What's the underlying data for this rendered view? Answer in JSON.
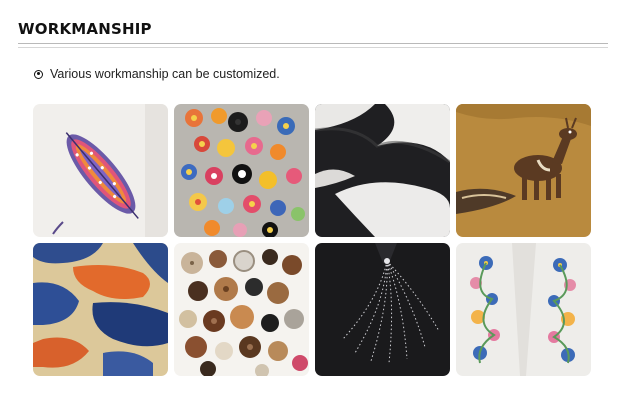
{
  "section": {
    "title": "WORKMANSHIP",
    "note": "Various workmanship can be customized."
  },
  "gallery": {
    "items": [
      {
        "icon": "feather-embroidery-image"
      },
      {
        "icon": "crochet-flowers-image"
      },
      {
        "icon": "mohair-stripe-image"
      },
      {
        "icon": "deer-intarsia-image"
      },
      {
        "icon": "camouflage-knit-image"
      },
      {
        "icon": "buttons-image"
      },
      {
        "icon": "rhinestone-image"
      },
      {
        "icon": "floral-embroidery-image"
      }
    ]
  },
  "colors": {
    "text": "#111111",
    "rule": "#b9b9b9"
  }
}
